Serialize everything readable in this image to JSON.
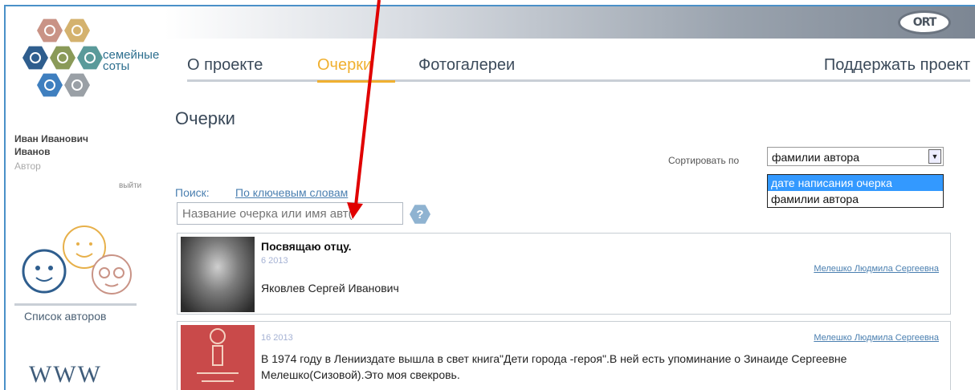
{
  "logo": {
    "text_line1": "семейные",
    "text_line2": "соты"
  },
  "ort_logo": "ORT",
  "user": {
    "first_line": "Иван Иванович",
    "second_line": "Иванов",
    "role": "Автор",
    "logout": "выйти"
  },
  "sidebar": {
    "authors_link": "Список авторов",
    "www": "WWW"
  },
  "nav": {
    "items": [
      {
        "label": "О проекте"
      },
      {
        "label": "Очерки"
      },
      {
        "label": "Фотогалереи"
      },
      {
        "label": "Поддержать проект"
      }
    ],
    "active_color": "#f0b030"
  },
  "page_title": "Очерки",
  "sort": {
    "label": "Сортировать по",
    "selected": "фамилии автора",
    "options": [
      "дате написания очерка",
      "фамилии автора"
    ],
    "highlighted_option": "дате написания очерка"
  },
  "search": {
    "label": "Поиск:",
    "mode_link": "По ключевым словам",
    "placeholder": "Название очерка или имя авт(",
    "help": "?"
  },
  "essays": [
    {
      "title": "Посвящаю отцу.",
      "date": "6 2013",
      "author": "Мелешко Людмила Сергеевна",
      "text": "Яковлев Сергей Иванович"
    },
    {
      "title": "",
      "date": "16 2013",
      "author": "Мелешко Людмила Сергеевна",
      "text": "В 1974 году в Ленииздате вышла в свет книга\"Дети города -героя\".В ней есть упоминание о Зинаиде Сергеевне Мелешко(Сизовой).Это моя свекровь."
    }
  ],
  "colors": {
    "accent": "#f0b030",
    "link": "#4a7fb0",
    "annotation_arrow": "#e00000",
    "select_highlight": "#3399ff"
  }
}
